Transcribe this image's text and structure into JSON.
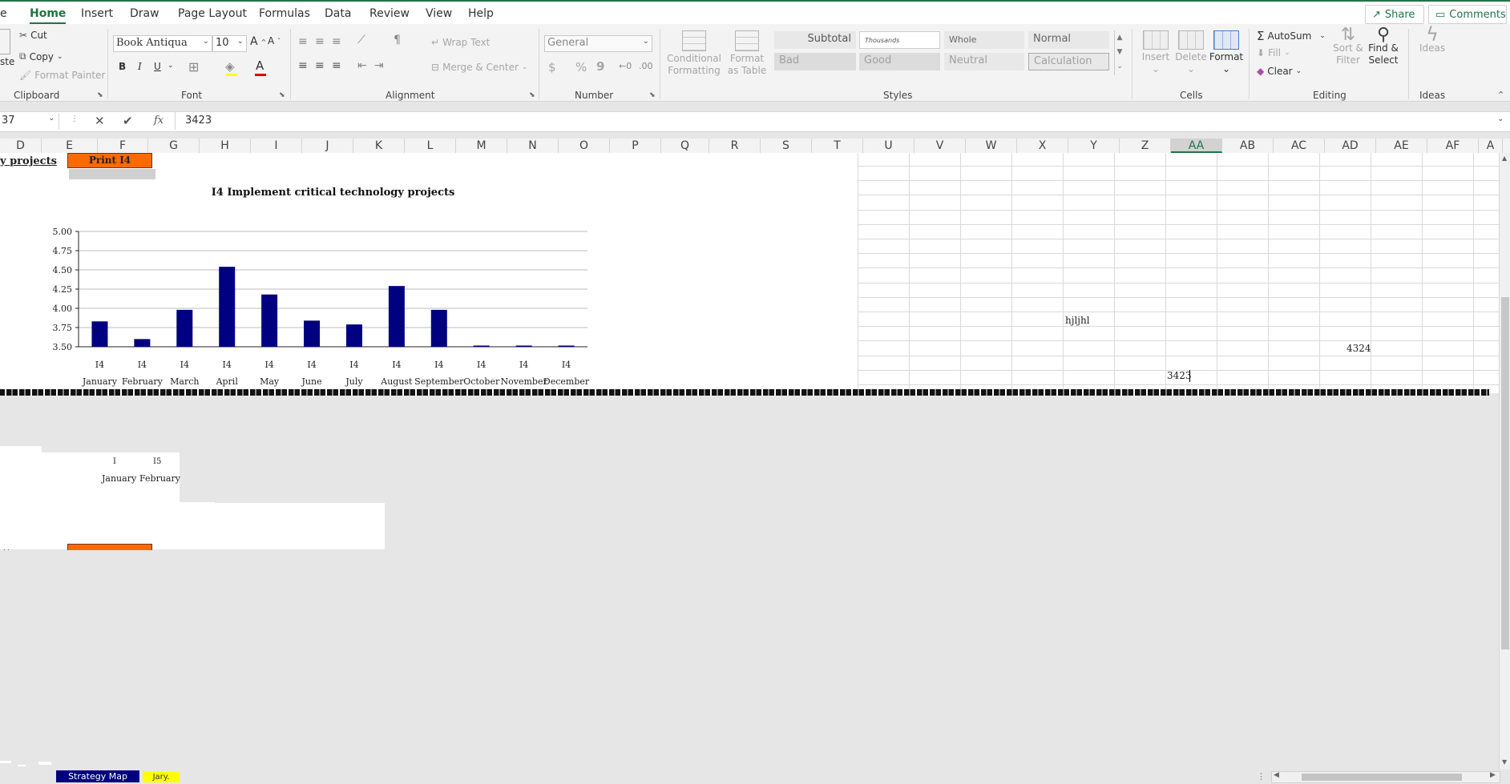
{
  "tabs": {
    "file_partial": "e",
    "home": "Home",
    "insert": "Insert",
    "draw": "Draw",
    "page_layout": "Page Layout",
    "formulas": "Formulas",
    "data": "Data",
    "review": "Review",
    "view": "View",
    "help": "Help"
  },
  "topright": {
    "share": "Share",
    "comments": "Comments"
  },
  "clipboard": {
    "paste_partial": "ste",
    "cut": "Cut",
    "copy": "Copy",
    "format_painter": "Format Painter",
    "label": "Clipboard"
  },
  "font": {
    "family": "Book Antiqua",
    "size": "10",
    "bold": "B",
    "italic": "I",
    "underline": "U",
    "color_letter": "A",
    "label": "Font"
  },
  "alignment": {
    "wrap_text": "Wrap Text",
    "merge_center": "Merge & Center",
    "label": "Alignment"
  },
  "number": {
    "format": "General",
    "currency": "$",
    "percent": "%",
    "comma": "9",
    "label": "Number"
  },
  "styles": {
    "conditional_formatting": "Conditional Formatting",
    "format_as_table": "Format as Table",
    "items": [
      "Subtotal",
      "Thousands",
      "Whole",
      "Normal",
      "Bad",
      "Good",
      "Neutral",
      "Calculation"
    ],
    "label": "Styles"
  },
  "cells": {
    "insert": "Insert",
    "delete": "Delete",
    "format": "Format",
    "label": "Cells"
  },
  "editing": {
    "autosum": "AutoSum",
    "fill": "Fill",
    "clear": "Clear",
    "sort_filter": "Sort & Filter",
    "find_select": "Find & Select",
    "label": "Editing"
  },
  "ideas": {
    "ideas": "Ideas",
    "label": "Ideas"
  },
  "formula_bar": {
    "name_box": "37",
    "fx": "fx",
    "value": "3423"
  },
  "columns": [
    "D",
    "E",
    "F",
    "G",
    "H",
    "I",
    "J",
    "K",
    "L",
    "M",
    "N",
    "O",
    "P",
    "Q",
    "R",
    "S",
    "T",
    "U",
    "V",
    "W",
    "X",
    "Y",
    "Z",
    "AA",
    "AB",
    "AC",
    "AD",
    "AE",
    "AF",
    "A"
  ],
  "selected_column": "AA",
  "sheet": {
    "title_partial": "y projects",
    "print_button": "Print I4",
    "cell_y": "hjljhl",
    "cell_ad": "4324",
    "cell_aa": "3423"
  },
  "lower": {
    "months": [
      "January",
      "February"
    ],
    "ticks": [
      "I",
      "I5"
    ]
  },
  "sheet_tabs": {
    "strategy_map": "Strategy Map",
    "yellow_tab": "Jary."
  },
  "chart_data": {
    "type": "bar",
    "title": "I4 Implement critical technology projects",
    "categories": [
      "January",
      "February",
      "March",
      "April",
      "May",
      "June",
      "July",
      "August",
      "September",
      "October",
      "November",
      "December"
    ],
    "category_sublabels": [
      "I4",
      "I4",
      "I4",
      "I4",
      "I4",
      "I4",
      "I4",
      "I4",
      "I4",
      "I4",
      "I4",
      "I4"
    ],
    "values": [
      3.83,
      3.6,
      3.98,
      4.54,
      4.18,
      3.84,
      3.79,
      4.29,
      3.98,
      3.5,
      3.5,
      3.5
    ],
    "ylim": [
      3.5,
      5.0
    ],
    "yticks": [
      "3.50",
      "3.75",
      "4.00",
      "4.25",
      "4.50",
      "4.75",
      "5.00"
    ],
    "grid": true,
    "color": "#000080"
  }
}
